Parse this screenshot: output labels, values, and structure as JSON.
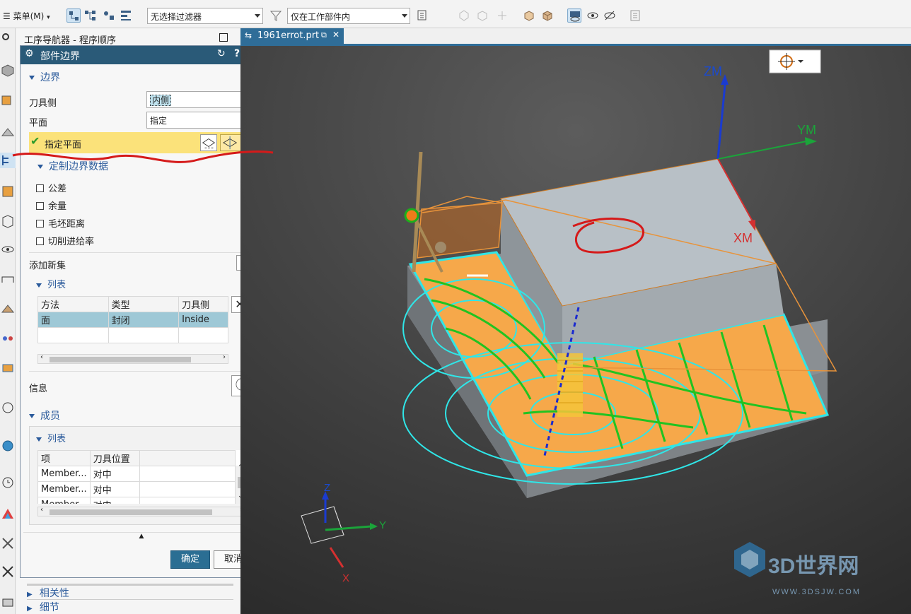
{
  "toolbar": {
    "menu_label": "菜单(M)",
    "filter_combo": "无选择过滤器",
    "scope_combo": "仅在工作部件内"
  },
  "navigator": {
    "title": "工序导航器 - 程序顺序"
  },
  "dialog": {
    "title": "部件边界",
    "boundary_section": "边界",
    "tool_side_label": "刀具侧",
    "tool_side_value": "内侧",
    "plane_label": "平面",
    "plane_value": "指定",
    "specify_plane_label": "指定平面",
    "custom_data_section": "定制边界数据",
    "checkboxes": [
      "公差",
      "余量",
      "毛坯距离",
      "切削进给率"
    ],
    "add_new_set_label": "添加新集",
    "list_section": "列表",
    "list_columns": [
      "方法",
      "类型",
      "刀具侧"
    ],
    "list_rows": [
      [
        "面",
        "封闭",
        "Inside"
      ]
    ],
    "info_label": "信息",
    "members_section": "成员",
    "members_list_section": "列表",
    "members_columns": [
      "项",
      "刀具位置"
    ],
    "members_rows": [
      [
        "Member...",
        "对中"
      ],
      [
        "Member...",
        "对中"
      ],
      [
        "Member...",
        "对中"
      ]
    ],
    "ok_button": "确定",
    "cancel_button": "取消"
  },
  "nav_footer": {
    "relations": "相关性",
    "details": "细节"
  },
  "tab": {
    "label": "1961errot.prt"
  },
  "viewport": {
    "axis_zm": "ZM",
    "axis_ym": "YM",
    "axis_xm": "XM",
    "triad_z": "Z",
    "triad_y": "Y",
    "triad_x": "X",
    "watermark_title": "3D世界网",
    "watermark_url": "WWW.3DSJW.COM"
  },
  "colors": {
    "dialog_title_bg": "#2a5a78",
    "tab_bg": "#2f6d98",
    "highlight_row": "#fbe27a",
    "face_orange": "#f6a84a",
    "toolpath_cyan": "#2fe6e8",
    "toolpath_green": "#21c321"
  }
}
